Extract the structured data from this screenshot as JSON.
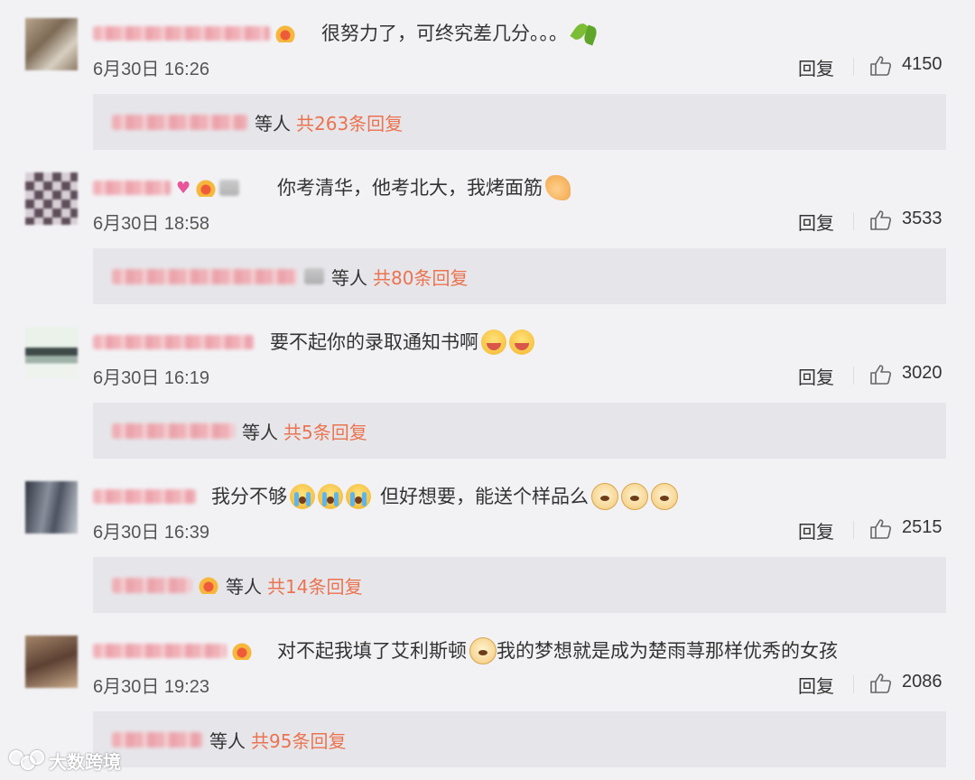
{
  "reply_label": "回复",
  "etc_label": "等人",
  "comments": [
    {
      "text_before": "很努力了，可终究差几分。。。",
      "text_after": "",
      "date": "6月30日 16:26",
      "likes": "4150",
      "replies_total": "共263条回复"
    },
    {
      "text_before": "你考清华，他考北大，我烤面筋",
      "text_after": "",
      "date": "6月30日 18:58",
      "likes": "3533",
      "replies_total": "共80条回复"
    },
    {
      "text_before": "要不起你的录取通知书啊",
      "text_after": "",
      "date": "6月30日 16:19",
      "likes": "3020",
      "replies_total": "共5条回复"
    },
    {
      "text_before": "我分不够",
      "text_after": "但好想要，能送个样品么",
      "date": "6月30日 16:39",
      "likes": "2515",
      "replies_total": "共14条回复"
    },
    {
      "text_before": "对不起我填了艾利斯顿",
      "text_after": "我的梦想就是成为楚雨荨那样优秀的女孩",
      "date": "6月30日 19:23",
      "likes": "2086",
      "replies_total": "共95条回复"
    }
  ],
  "watermark": {
    "text": "大数跨境"
  },
  "colors": {
    "accent": "#eb7350",
    "background": "#f2f2f5",
    "reply_box": "#e6e6ea"
  },
  "icons": [
    "leaf-emoji-icon",
    "hand-emoji-icon",
    "laugh-emoji-icon",
    "cry-emoji-icon",
    "doge-emoji-icon",
    "thumbs-up-icon",
    "badge-icon"
  ]
}
